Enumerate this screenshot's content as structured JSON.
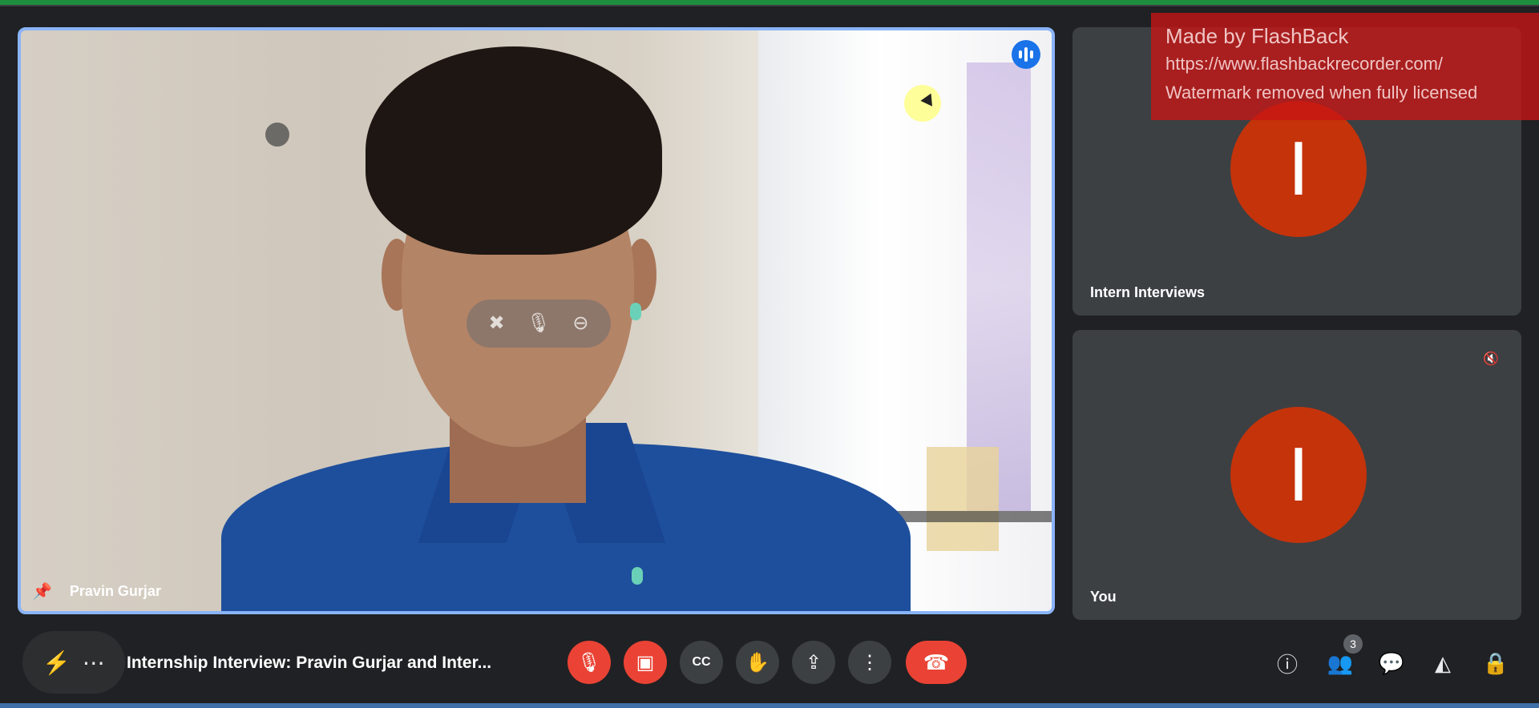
{
  "watermark": {
    "line1": "Made by FlashBack",
    "line2": "https://www.flashbackrecorder.com/",
    "line3": "Watermark removed when fully licensed"
  },
  "main_tile": {
    "participant_name": "Pravin Gurjar",
    "pin_icon": "pin-icon",
    "speaking_icon": "speaking-indicator-icon",
    "hover_controls": [
      "unpin-icon",
      "mic-icon",
      "remove-icon"
    ]
  },
  "side_tiles": [
    {
      "name": "Intern Interviews",
      "initial": "I",
      "avatar_color": "#c5330b"
    },
    {
      "name": "You",
      "initial": "I",
      "avatar_color": "#c5330b",
      "muted": true
    }
  ],
  "bottom_bar": {
    "meeting_title": "Internship Interview: Pravin Gurjar and Inter...",
    "more_label": "⋯",
    "controls": [
      {
        "name": "mic-off",
        "icon": "mic-off-icon",
        "glyph": "🎙",
        "state": "off"
      },
      {
        "name": "camera-off",
        "icon": "camera-off-icon",
        "glyph": "▣",
        "state": "off"
      },
      {
        "name": "captions",
        "icon": "captions-icon",
        "glyph": "CC"
      },
      {
        "name": "raise-hand",
        "icon": "hand-icon",
        "glyph": "✋"
      },
      {
        "name": "present",
        "icon": "present-icon",
        "glyph": "⇪"
      },
      {
        "name": "more-options",
        "icon": "more-vert-icon",
        "glyph": "⋮"
      },
      {
        "name": "leave-call",
        "icon": "call-end-icon",
        "glyph": "☎"
      }
    ],
    "right_controls": [
      {
        "name": "meeting-details",
        "icon": "info-icon",
        "glyph": "ⓘ"
      },
      {
        "name": "people",
        "icon": "people-icon",
        "glyph": "👥",
        "badge": "3"
      },
      {
        "name": "chat",
        "icon": "chat-icon",
        "glyph": "💬"
      },
      {
        "name": "activities",
        "icon": "activities-icon",
        "glyph": "◭"
      },
      {
        "name": "host-controls",
        "icon": "lock-person-icon",
        "glyph": "🔒"
      }
    ]
  },
  "colors": {
    "accent_blue": "#8ab4f8",
    "red": "#ea4335",
    "avatar": "#c5330b",
    "background": "#202124",
    "tile": "#3c4043"
  }
}
